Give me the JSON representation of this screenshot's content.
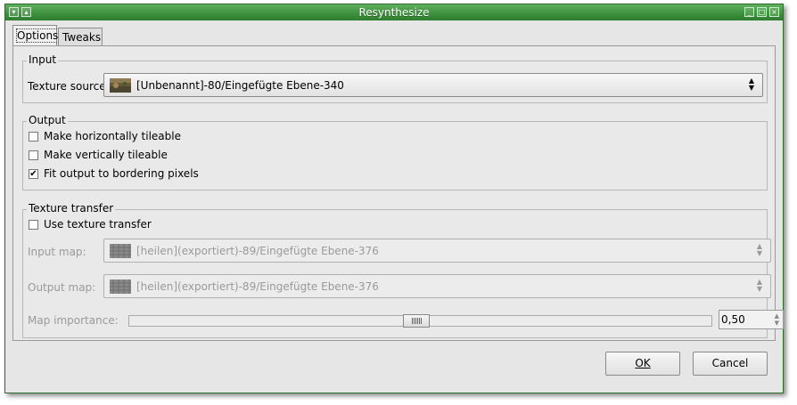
{
  "window": {
    "title": "Resynthesize"
  },
  "tabs": [
    {
      "label": "Options"
    },
    {
      "label": "Tweaks"
    }
  ],
  "input_group": {
    "legend": "Input",
    "texture_source_label": "Texture source:",
    "texture_source_value": "[Unbenannt]-80/Eingefügte Ebene-340"
  },
  "output_group": {
    "legend": "Output",
    "checks": [
      {
        "label": "Make horizontally tileable",
        "checked": false
      },
      {
        "label": "Make vertically tileable",
        "checked": false
      },
      {
        "label": "Fit output to bordering pixels",
        "checked": true
      }
    ]
  },
  "transfer_group": {
    "legend": "Texture transfer",
    "use_label": "Use texture transfer",
    "use_checked": false,
    "input_map_label": "Input map:",
    "input_map_value": "[heilen](exportiert)-89/Eingefügte Ebene-376",
    "output_map_label": "Output map:",
    "output_map_value": "[heilen](exportiert)-89/Eingefügte Ebene-376",
    "importance_label": "Map importance:",
    "importance_value": "0,50"
  },
  "buttons": {
    "ok_label": "OK",
    "cancel_label": "Cancel"
  },
  "colors": {
    "titlebar": "#3c8f3c",
    "window_bg": "#e6e6e6"
  },
  "icons": [
    "window-menu-icon",
    "shade-icon",
    "minimize-icon",
    "maximize-icon",
    "close-icon",
    "checkmark-icon",
    "combo-arrows-icon"
  ]
}
